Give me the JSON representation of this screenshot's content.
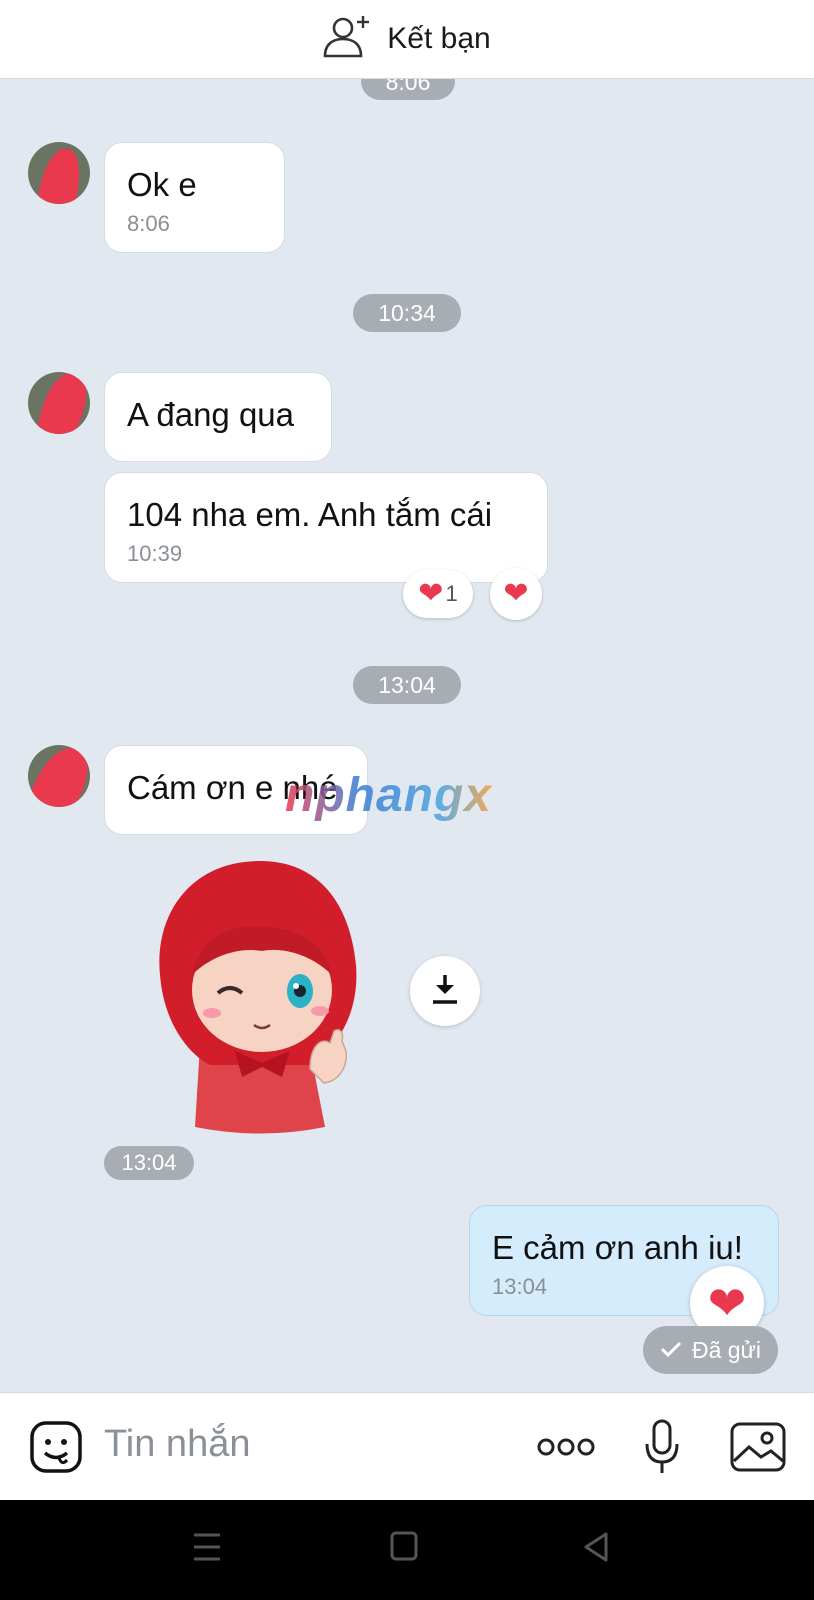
{
  "header": {
    "add_friend_label": "Kết bạn",
    "icon": "add-friend-icon"
  },
  "timestamps": {
    "top_partial": "8:06",
    "pill_1": "10:34",
    "pill_2": "13:04",
    "sticker_time": "13:04"
  },
  "messages": [
    {
      "sender": "other",
      "text": "Ok e",
      "time": "8:06"
    },
    {
      "sender": "other",
      "text": "A đang qua",
      "time": ""
    },
    {
      "sender": "other",
      "text": "104 nha em. Anh tắm cái",
      "time": "10:39",
      "reactions": [
        {
          "emoji": "❤",
          "count": "1"
        },
        {
          "emoji": "❤",
          "count": ""
        }
      ]
    },
    {
      "sender": "other",
      "text": "Cám ơn e nhé",
      "time": ""
    },
    {
      "sender": "me",
      "text": "E cảm ơn anh iu!",
      "time": "13:04",
      "status": "Đã gửi"
    }
  ],
  "watermark": "nphangx",
  "composer": {
    "placeholder": "Tin nhắn",
    "icons": [
      "sticker-icon",
      "more-icon",
      "microphone-icon",
      "image-icon"
    ]
  },
  "colors": {
    "background": "#e2e8f0",
    "my_bubble": "#d4ecfb",
    "heart": "#e8394e",
    "time_pill": "#a8adb3"
  }
}
